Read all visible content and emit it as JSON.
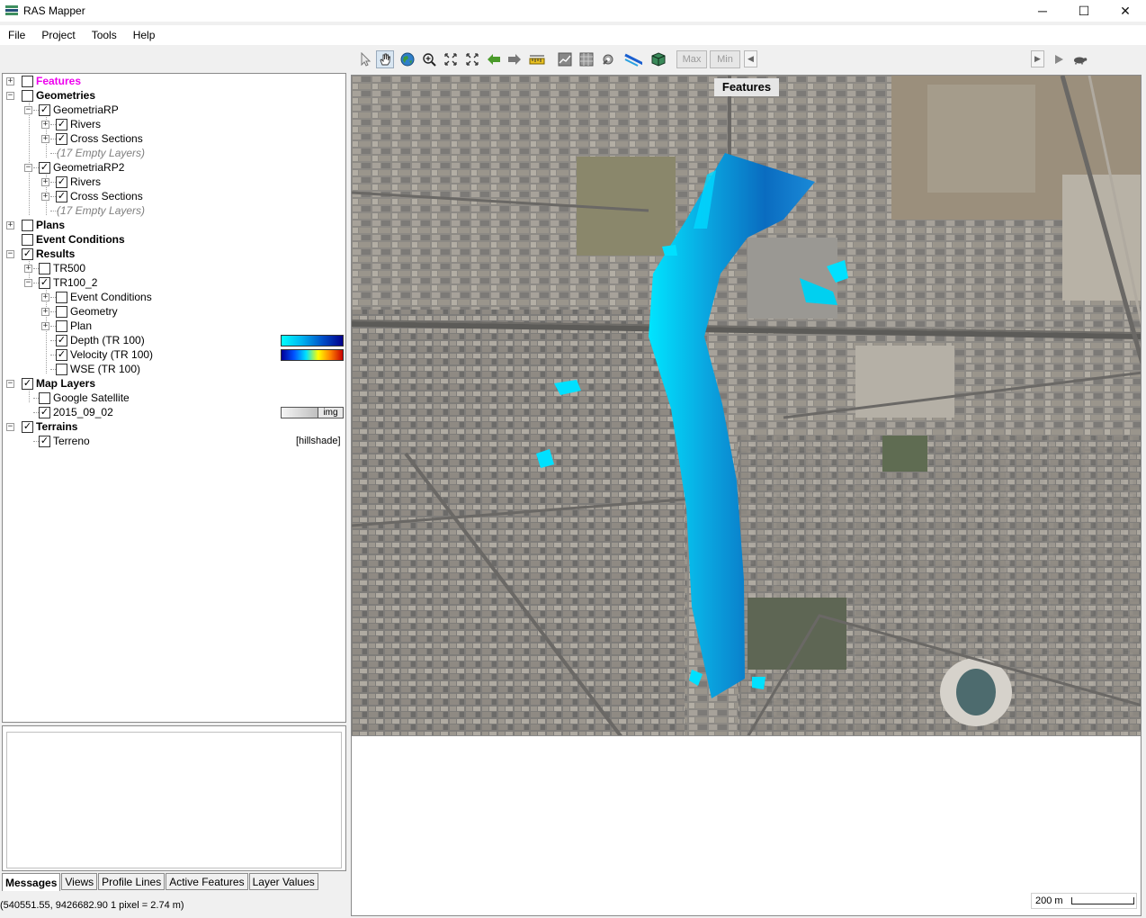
{
  "window": {
    "title": "RAS Mapper",
    "minimize": "─",
    "maximize": "☐",
    "close": "✕"
  },
  "menu": [
    "File",
    "Project",
    "Tools",
    "Help"
  ],
  "toolbar": {
    "max_label": "Max",
    "min_label": "Min",
    "scroll_left": "◀",
    "scroll_right": "▶"
  },
  "tree": {
    "features": "Features",
    "geometries": "Geometries",
    "geom1": "GeometriaRP",
    "geom1_rivers": "Rivers",
    "geom1_xs": "Cross Sections",
    "geom1_empty": "(17 Empty Layers)",
    "geom2": "GeometriaRP2",
    "geom2_rivers": "Rivers",
    "geom2_xs": "Cross Sections",
    "geom2_empty": "(17 Empty Layers)",
    "plans": "Plans",
    "event_conditions": "Event Conditions",
    "results": "Results",
    "tr500": "TR500",
    "tr100_2": "TR100_2",
    "res_event": "Event Conditions",
    "res_geometry": "Geometry",
    "res_plan": "Plan",
    "depth": "Depth (TR 100)",
    "velocity": "Velocity (TR 100)",
    "wse": "WSE (TR 100)",
    "map_layers": "Map Layers",
    "google_sat": "Google Satellite",
    "img_layer": "2015_09_02",
    "img_tag": "img",
    "terrains": "Terrains",
    "terreno": "Terreno",
    "hillshade": "[hillshade]"
  },
  "tabs": [
    "Messages",
    "Views",
    "Profile Lines",
    "Active Features",
    "Layer Values"
  ],
  "status": "(540551.55, 9426682.90  1 pixel = 2.74 m)",
  "map": {
    "overlay_label": "Features",
    "scale_label": "200 m"
  },
  "colors": {
    "features_label": "#ee00ee",
    "flood_light": "#00e5ff",
    "flood_dark": "#0a5fb0"
  }
}
